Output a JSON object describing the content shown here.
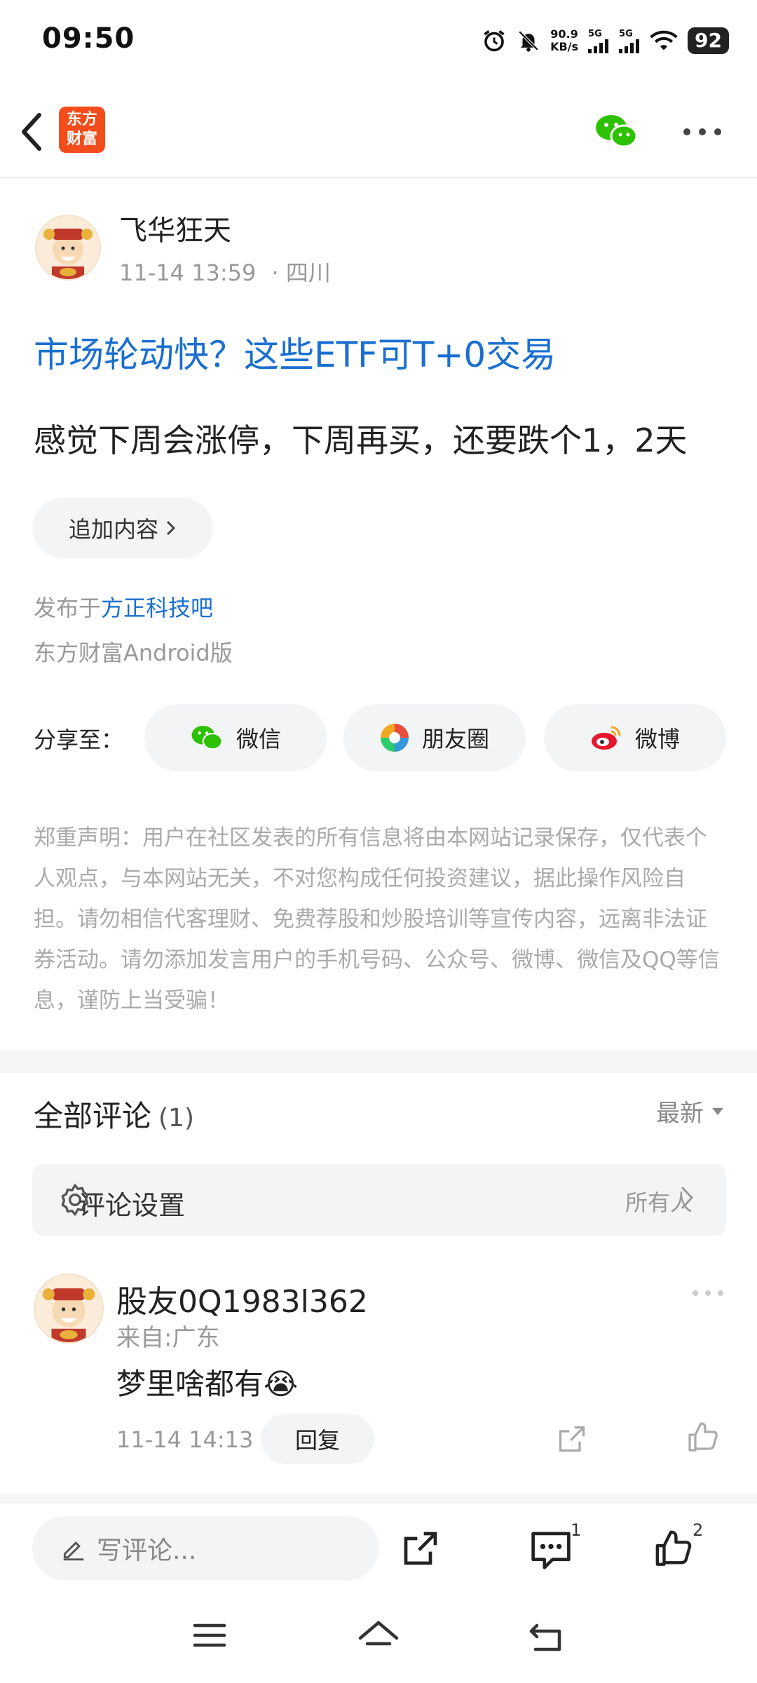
{
  "status_bar": {
    "time": "09:50",
    "speed_value": "90.9",
    "speed_unit": "KB/s",
    "signal1": "5G",
    "signal2": "5G",
    "battery": "92"
  },
  "nav": {
    "logo_line1": "东方",
    "logo_line2": "财富",
    "icons": [
      "back-arrow-icon",
      "wechat-icon",
      "more-icon"
    ]
  },
  "post": {
    "author": "飞华狂天",
    "time": "11-14 13:59",
    "location": "· 四川",
    "headline": "市场轮动快？这些ETF可T+0交易",
    "body": "感觉下周会涨停，下周再买，还要跌个1，2天",
    "add_content": "追加内容",
    "published_prefix": "发布于",
    "published_link": "方正科技吧",
    "client": "东方财富Android版"
  },
  "share": {
    "label": "分享至：",
    "wechat": "微信",
    "moments": "朋友圈",
    "weibo": "微博"
  },
  "disclaimer": "郑重声明：用户在社区发表的所有信息将由本网站记录保存，仅代表个人观点，与本网站无关，不对您构成任何投资建议，据此操作风险自担。请勿相信代客理财、免费荐股和炒股培训等宣传内容，远离非法证券活动。请勿添加发言用户的手机号码、公众号、微博、微信及QQ等信息，谨防上当受骗！",
  "comments": {
    "title": "全部评论",
    "count": "(1)",
    "sort": "最新",
    "settings_label": "评论设置",
    "settings_value": "所有人",
    "items": [
      {
        "name": "股友0Q1983l362",
        "location": "来自:广东",
        "text": "梦里啥都有😭",
        "time": "11-14 14:13",
        "reply": "回复"
      }
    ]
  },
  "bottom_bar": {
    "placeholder": "写评论...",
    "comment_count": "1",
    "like_count": "2"
  },
  "colors": {
    "accent_blue": "#1a6fd0",
    "brand_orange": "#f24d1b",
    "wechat_green": "#2dc100"
  }
}
